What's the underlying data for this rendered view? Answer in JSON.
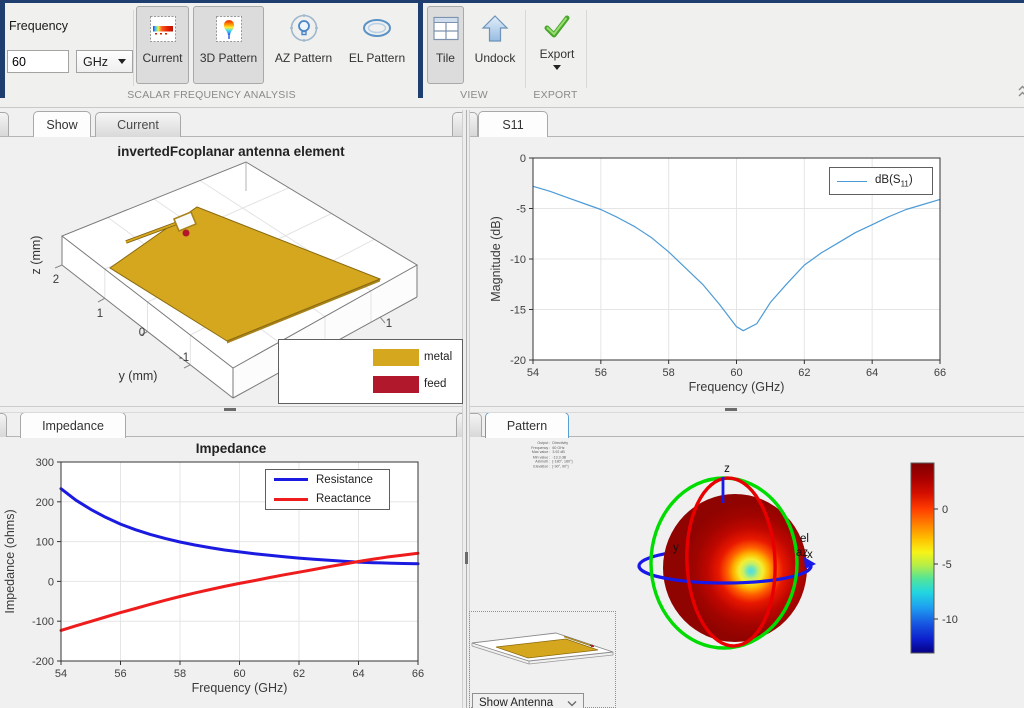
{
  "window": {
    "accent_color": "#1d3e6f"
  },
  "toolbar": {
    "frequency_label": "Frequency",
    "frequency_value": "60",
    "frequency_unit": "GHz",
    "buttons": [
      {
        "label": "Current",
        "pressed": true,
        "icon": "current-plot-icon"
      },
      {
        "label": "3D Pattern",
        "pressed": true,
        "icon": "pattern-3d-icon"
      },
      {
        "label": "AZ Pattern",
        "pressed": false,
        "icon": "azimuth-pattern-icon"
      },
      {
        "label": "EL Pattern",
        "pressed": false,
        "icon": "elevation-pattern-icon"
      },
      {
        "label": "Tile",
        "pressed": true,
        "icon": "tile-layout-icon"
      },
      {
        "label": "Undock",
        "pressed": false,
        "icon": "undock-arrow-icon"
      },
      {
        "label": "Export",
        "pressed": false,
        "icon": "export-check-icon",
        "has_dropdown": true
      }
    ],
    "sections": [
      {
        "label": "SCALAR FREQUENCY ANALYSIS"
      },
      {
        "label": "VIEW"
      },
      {
        "label": "EXPORT"
      }
    ]
  },
  "panels": {
    "antenna": {
      "tabs": [
        {
          "label": "Show",
          "selected": true
        },
        {
          "label": "Current",
          "selected": false
        }
      ],
      "title": "invertedFcoplanar antenna element",
      "axes": {
        "z_label": "z (mm)",
        "y_label": "y (mm)",
        "z_tick": "2",
        "y_tick_1": "1",
        "y_tick_0": "0",
        "y_tick_m1": "-1",
        "x_tick": "1"
      },
      "legend": [
        {
          "label": "metal",
          "color": "#d5a71f"
        },
        {
          "label": "feed",
          "color": "#b2182b"
        }
      ]
    },
    "s11": {
      "tab": "S11"
    },
    "impedance": {
      "tab": "Impedance"
    },
    "pattern": {
      "tab": "Pattern",
      "info": [
        {
          "label": "Output",
          "value": "Directivity"
        },
        {
          "label": "Frequency",
          "value": "60 GHz"
        },
        {
          "label": "Max value",
          "value": "3.92 dB"
        },
        {
          "label": "Min value",
          "value": "-13.3 dB"
        },
        {
          "label": "Azimuth",
          "value": "[-180°, 180°]"
        },
        {
          "label": "Elevation",
          "value": "[-90°, 90°]"
        }
      ],
      "axis_labels": {
        "z": "z",
        "el": "el",
        "az": "az",
        "x": "x",
        "y": "y"
      },
      "colorbar": {
        "ticks": [
          "0",
          "-5",
          "-10"
        ]
      },
      "show_antenna_label": "Show Antenna"
    }
  },
  "chart_data": [
    {
      "type": "line",
      "title": "",
      "xlabel": "Frequency (GHz)",
      "ylabel": "Magnitude (dB)",
      "xlim": [
        54,
        66
      ],
      "ylim": [
        -20,
        0
      ],
      "xticks": [
        54,
        56,
        58,
        60,
        62,
        64,
        66
      ],
      "yticks": [
        0,
        -5,
        -10,
        -15,
        -20
      ],
      "grid": true,
      "legend_position": "top-right",
      "series": [
        {
          "name": "dB(S11)",
          "color": "#4d9bd6",
          "width": 1.2,
          "x": [
            54,
            54.5,
            55,
            55.5,
            56,
            56.5,
            57,
            57.5,
            58,
            58.5,
            59,
            59.5,
            60,
            60.2,
            60.6,
            61,
            61.5,
            62,
            62.5,
            63,
            63.5,
            64,
            64.5,
            65,
            65.5,
            66
          ],
          "y": [
            -2.8,
            -3.3,
            -3.9,
            -4.5,
            -5.1,
            -5.9,
            -6.8,
            -7.9,
            -9.3,
            -10.9,
            -12.5,
            -14.5,
            -16.7,
            -17.1,
            -16.4,
            -14.3,
            -12.4,
            -10.6,
            -9.4,
            -8.4,
            -7.4,
            -6.6,
            -5.8,
            -5.1,
            -4.6,
            -4.1
          ]
        }
      ]
    },
    {
      "type": "line",
      "title": "Impedance",
      "xlabel": "Frequency (GHz)",
      "ylabel": "Impedance (ohms)",
      "xlim": [
        54,
        66
      ],
      "ylim": [
        -200,
        300
      ],
      "xticks": [
        54,
        56,
        58,
        60,
        62,
        64,
        66
      ],
      "yticks": [
        300,
        200,
        100,
        0,
        -100,
        -200
      ],
      "grid": true,
      "legend_position": "top-right",
      "series": [
        {
          "name": "Resistance",
          "color": "#1a1ae0",
          "width": 3,
          "x": [
            54,
            54.5,
            55,
            55.5,
            56,
            56.5,
            57,
            57.5,
            58,
            58.5,
            59,
            59.5,
            60,
            60.5,
            61,
            61.5,
            62,
            62.5,
            63,
            63.5,
            64,
            64.5,
            65,
            65.5,
            66
          ],
          "y": [
            233,
            204,
            181,
            161,
            144,
            130,
            118,
            108,
            99,
            91.5,
            85,
            79,
            74,
            69.5,
            65.5,
            62,
            58.5,
            55.5,
            53,
            50.5,
            48.5,
            47,
            46,
            45,
            44.5
          ]
        },
        {
          "name": "Reactance",
          "color": "#ee1c1c",
          "width": 3,
          "x": [
            54,
            54.5,
            55,
            55.5,
            56,
            56.5,
            57,
            57.5,
            58,
            58.5,
            59,
            59.5,
            60,
            60.5,
            61,
            61.5,
            62,
            62.5,
            63,
            63.5,
            64,
            64.5,
            65,
            65.5,
            66
          ],
          "y": [
            -123,
            -111.5,
            -100.5,
            -89.5,
            -78.5,
            -68,
            -57.5,
            -47.5,
            -38,
            -29,
            -20.5,
            -12.5,
            -5,
            2,
            9.5,
            16.5,
            23,
            30,
            37,
            43.5,
            50,
            56,
            61.5,
            66,
            70.5
          ]
        }
      ]
    }
  ]
}
